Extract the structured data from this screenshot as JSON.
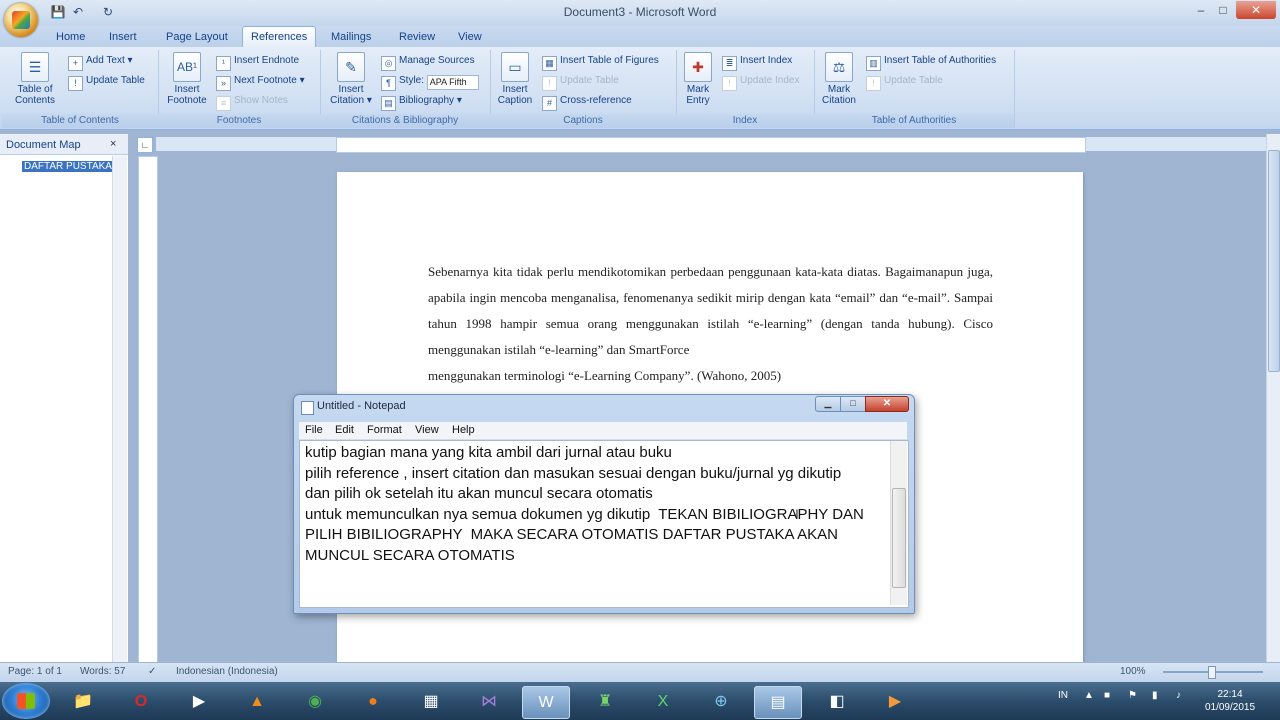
{
  "window": {
    "title": "Document3 - Microsoft Word",
    "controls": {
      "minimize": "–",
      "maximize": "□",
      "close": "✕"
    }
  },
  "quick_access": {
    "save": "💾",
    "undo": "↶",
    "redo": "↻"
  },
  "tabs": [
    "Home",
    "Insert",
    "Page Layout",
    "References",
    "Mailings",
    "Review",
    "View"
  ],
  "active_tab": "References",
  "ribbon": {
    "toc": {
      "big": "Table of Contents",
      "add_text": "Add Text ▾",
      "update_table": "Update Table",
      "label": "Table of Contents"
    },
    "footnotes": {
      "big": "Insert Footnote",
      "insert_endnote": "Insert Endnote",
      "next_footnote": "Next Footnote ▾",
      "show_notes": "Show Notes",
      "label": "Footnotes"
    },
    "citations": {
      "big": "Insert Citation ▾",
      "manage_sources": "Manage Sources",
      "style_label": "Style:",
      "style_value": "APA Fifth",
      "bibliography": "Bibliography ▾",
      "label": "Citations & Bibliography"
    },
    "captions": {
      "big": "Insert Caption",
      "insert_tof": "Insert Table of Figures",
      "update_table": "Update Table",
      "cross_reference": "Cross-reference",
      "label": "Captions"
    },
    "index": {
      "big": "Mark Entry",
      "insert_index": "Insert Index",
      "update_index": "Update Index",
      "label": "Index"
    },
    "toa": {
      "big": "Mark Citation",
      "insert_toa": "Insert Table of Authorities",
      "update_table": "Update Table",
      "label": "Table of Authorities"
    }
  },
  "document_map": {
    "title": "Document Map",
    "close": "×",
    "items": [
      "DAFTAR PUSTAKA"
    ]
  },
  "document": {
    "paragraph1": "Sebenarnya kita tidak perlu mendikotomikan perbedaan penggunaan kata-kata diatas. Bagaimanapun juga, apabila ingin mencoba menganalisa, fenomenanya sedikit mirip dengan kata “email” dan “e-mail”. Sampai tahun 1998 hampir semua orang menggunakan istilah “e-learning” (dengan tanda hubung). Cisco menggunakan istilah “e-learning” dan SmartForce",
    "paragraph2": "menggunakan terminologi “e-Learning Company”. (Wahono, 2005)"
  },
  "notepad": {
    "title": "Untitled - Notepad",
    "menu": [
      "File",
      "Edit",
      "Format",
      "View",
      "Help"
    ],
    "text": "kutip bagian mana yang kita ambil dari jurnal atau buku\npilih reference , insert citation dan masukan sesuai dengan buku/jurnal yg dikutip\ndan pilih ok setelah itu akan muncul secara otomatis\nuntuk memunculkan nya semua dokumen yg dikutip  TEKAN BIBILIOGRAPHY DAN PILIH BIBILIOGRAPHY  MAKA SECARA OTOMATIS DAFTAR PUSTAKA AKAN MUNCUL SECARA OTOMATIS"
  },
  "status": {
    "page": "Page: 1 of 1",
    "words": "Words: 57",
    "language": "Indonesian (Indonesia)",
    "zoom": "100%",
    "zoom_level": 0.5
  },
  "taskbar": {
    "apps": [
      "explorer",
      "opera",
      "media-player",
      "vlc",
      "chrome",
      "firefox",
      "calculator",
      "visual-studio",
      "word",
      "matlab",
      "excel",
      "network",
      "notepad",
      "outlook",
      "powerpoint"
    ],
    "language": "IN",
    "time": "22:14",
    "date": "01/09/2015"
  },
  "colors": {
    "ribbon": "#d3e1f3",
    "accent": "#15428b",
    "taskbar": "#2c4d6c"
  }
}
